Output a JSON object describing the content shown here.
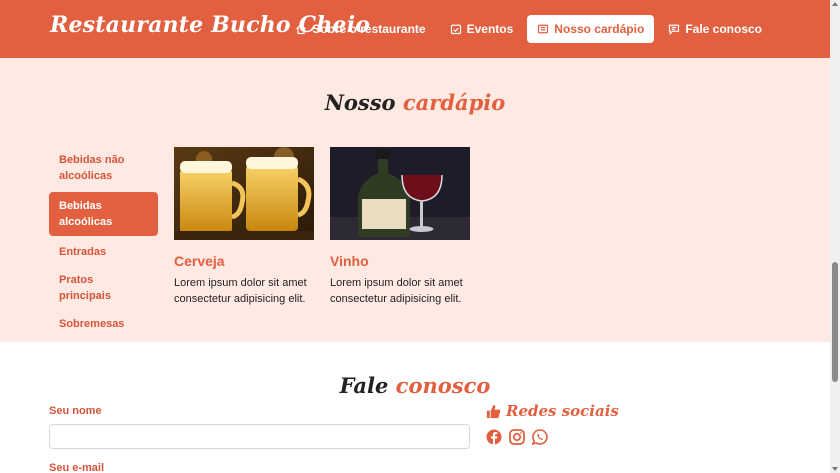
{
  "brand": "Restaurante Bucho Cheio",
  "nav": [
    {
      "label": "Sobre o restaurante",
      "icon": "home-icon"
    },
    {
      "label": "Eventos",
      "icon": "calendar-check-icon"
    },
    {
      "label": "Nosso cardápio",
      "icon": "menu-card-icon",
      "active": true
    },
    {
      "label": "Fale conosco",
      "icon": "message-icon"
    }
  ],
  "menu": {
    "title_a": "Nosso",
    "title_b": "cardápio",
    "categories": [
      {
        "label": "Bebidas não alcoólicas"
      },
      {
        "label": "Bebidas alcoólicas",
        "active": true
      },
      {
        "label": "Entradas"
      },
      {
        "label": "Pratos principais"
      },
      {
        "label": "Sobremesas"
      }
    ],
    "items": [
      {
        "title": "Cerveja",
        "text": "Lorem ipsum dolor sit amet consectetur adipisicing elit."
      },
      {
        "title": "Vinho",
        "text": "Lorem ipsum dolor sit amet consectetur adipisicing elit."
      }
    ]
  },
  "contact": {
    "title_a": "Fale",
    "title_b": "conosco",
    "name_label": "Seu nome",
    "email_label": "Seu e-mail",
    "social_title": "Redes sociais",
    "social_icons": [
      "facebook-icon",
      "instagram-icon",
      "whatsapp-icon"
    ]
  },
  "colors": {
    "accent": "#e2603f",
    "section_bg": "#ffe9e3"
  }
}
